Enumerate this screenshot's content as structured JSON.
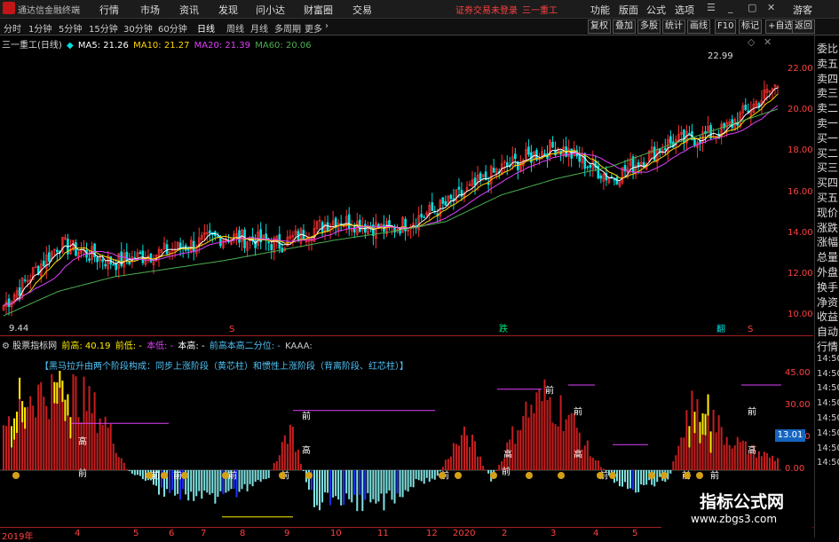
{
  "menubar": {
    "app_title": "通达信金融终端",
    "items": [
      "行情",
      "市场",
      "资讯",
      "发现",
      "问小达",
      "财富圈",
      "交易"
    ],
    "login_status": "证券交易未登录",
    "stock_name": "三一重工",
    "right_items": [
      "功能",
      "版面",
      "公式",
      "选项"
    ],
    "guest": "游客"
  },
  "period_bar": {
    "periods": [
      "分时",
      "1分钟",
      "5分钟",
      "15分钟",
      "30分钟",
      "60分钟",
      "日线",
      "周线",
      "月线",
      "多周期",
      "更多"
    ],
    "selected": "日线",
    "right_buttons": [
      "复权",
      "叠加",
      "多股",
      "统计",
      "画线",
      "F10",
      "标记",
      "+自选",
      "返回"
    ]
  },
  "ma_line": {
    "title": "三一重工(日线)",
    "ma5": "MA5: 21.26",
    "ma10": "MA10: 21.27",
    "ma20": "MA20: 21.39",
    "ma60": "MA60: 20.06"
  },
  "price_axis": [
    "22.00",
    "20.00",
    "18.00",
    "16.00",
    "14.00",
    "12.00",
    "10.00"
  ],
  "price_annotations": {
    "high": "22.99",
    "low": "9.44"
  },
  "price_markers": {
    "m1": "S",
    "m2": "跌",
    "m3": "翻",
    "m4": "S"
  },
  "indicator_line": {
    "title": "股票指标网",
    "a": "前高: 40.19",
    "b": "前低: -",
    "c": "本低: -",
    "d": "本高: -",
    "e": "前高本高二分位: -",
    "f": "KAAA:"
  },
  "indicator_text": "【黑马拉升由两个阶段构成：同步上涨阶段（黄芯柱）和惯性上涨阶段（背离阶段、红芯柱）】",
  "ind_axis": [
    "45.00",
    "30.00",
    "15.00",
    "0.00"
  ],
  "ind_value_badge": "13.01",
  "bar_labels": {
    "qian": "前",
    "gao": "高"
  },
  "date_axis": [
    "2019年",
    "4",
    "5",
    "6",
    "7",
    "8",
    "9",
    "10",
    "11",
    "12",
    "2020",
    "2",
    "3",
    "4",
    "5"
  ],
  "right_panel": [
    "委比",
    "卖五",
    "卖四",
    "卖三",
    "卖二",
    "卖一",
    "买一",
    "买二",
    "买三",
    "买四",
    "买五",
    "现价",
    "涨跌",
    "涨幅",
    "总量",
    "外盘",
    "换手",
    "净资",
    "收益",
    "自动",
    "行情",
    "14:50",
    "14:50",
    "14:50",
    "14:50",
    "14:50",
    "14:50",
    "14:50",
    "14:50"
  ],
  "watermark": {
    "title": "指标公式网",
    "url": "www.zbgs3.com"
  },
  "colors": {
    "ma5": "#ffffff",
    "ma10": "#ffd600",
    "ma20": "#e040fb",
    "ma60": "#4caf50",
    "up": "#ff3030",
    "down": "#00e0e0",
    "bar_red": "#c81e1e",
    "bar_yellow": "#ffee00",
    "bar_cyan": "#7fe3e3",
    "bar_blue": "#2030ff",
    "accent": "#ff4040"
  },
  "chart_data": {
    "type": "line",
    "note_series": "daily close, approximated",
    "x": [
      "2019-03",
      "2019-04",
      "2019-05",
      "2019-06",
      "2019-07",
      "2019-08",
      "2019-09",
      "2019-10",
      "2019-11",
      "2019-12",
      "2020-01",
      "2020-02",
      "2020-03",
      "2020-04",
      "2020-05"
    ],
    "series": [
      {
        "name": "MA5",
        "values": [
          10.5,
          13.5,
          12.6,
          13.2,
          13.9,
          13.5,
          14.7,
          14.2,
          15.4,
          17.2,
          18.3,
          16.7,
          18.4,
          19.0,
          21.3
        ]
      },
      {
        "name": "MA60",
        "values": [
          10.0,
          11.2,
          11.9,
          12.3,
          12.7,
          13.2,
          13.7,
          14.1,
          14.6,
          15.9,
          16.7,
          17.3,
          18.3,
          19.2,
          20.1
        ]
      }
    ],
    "ylim": [
      9.0,
      23.0
    ]
  }
}
